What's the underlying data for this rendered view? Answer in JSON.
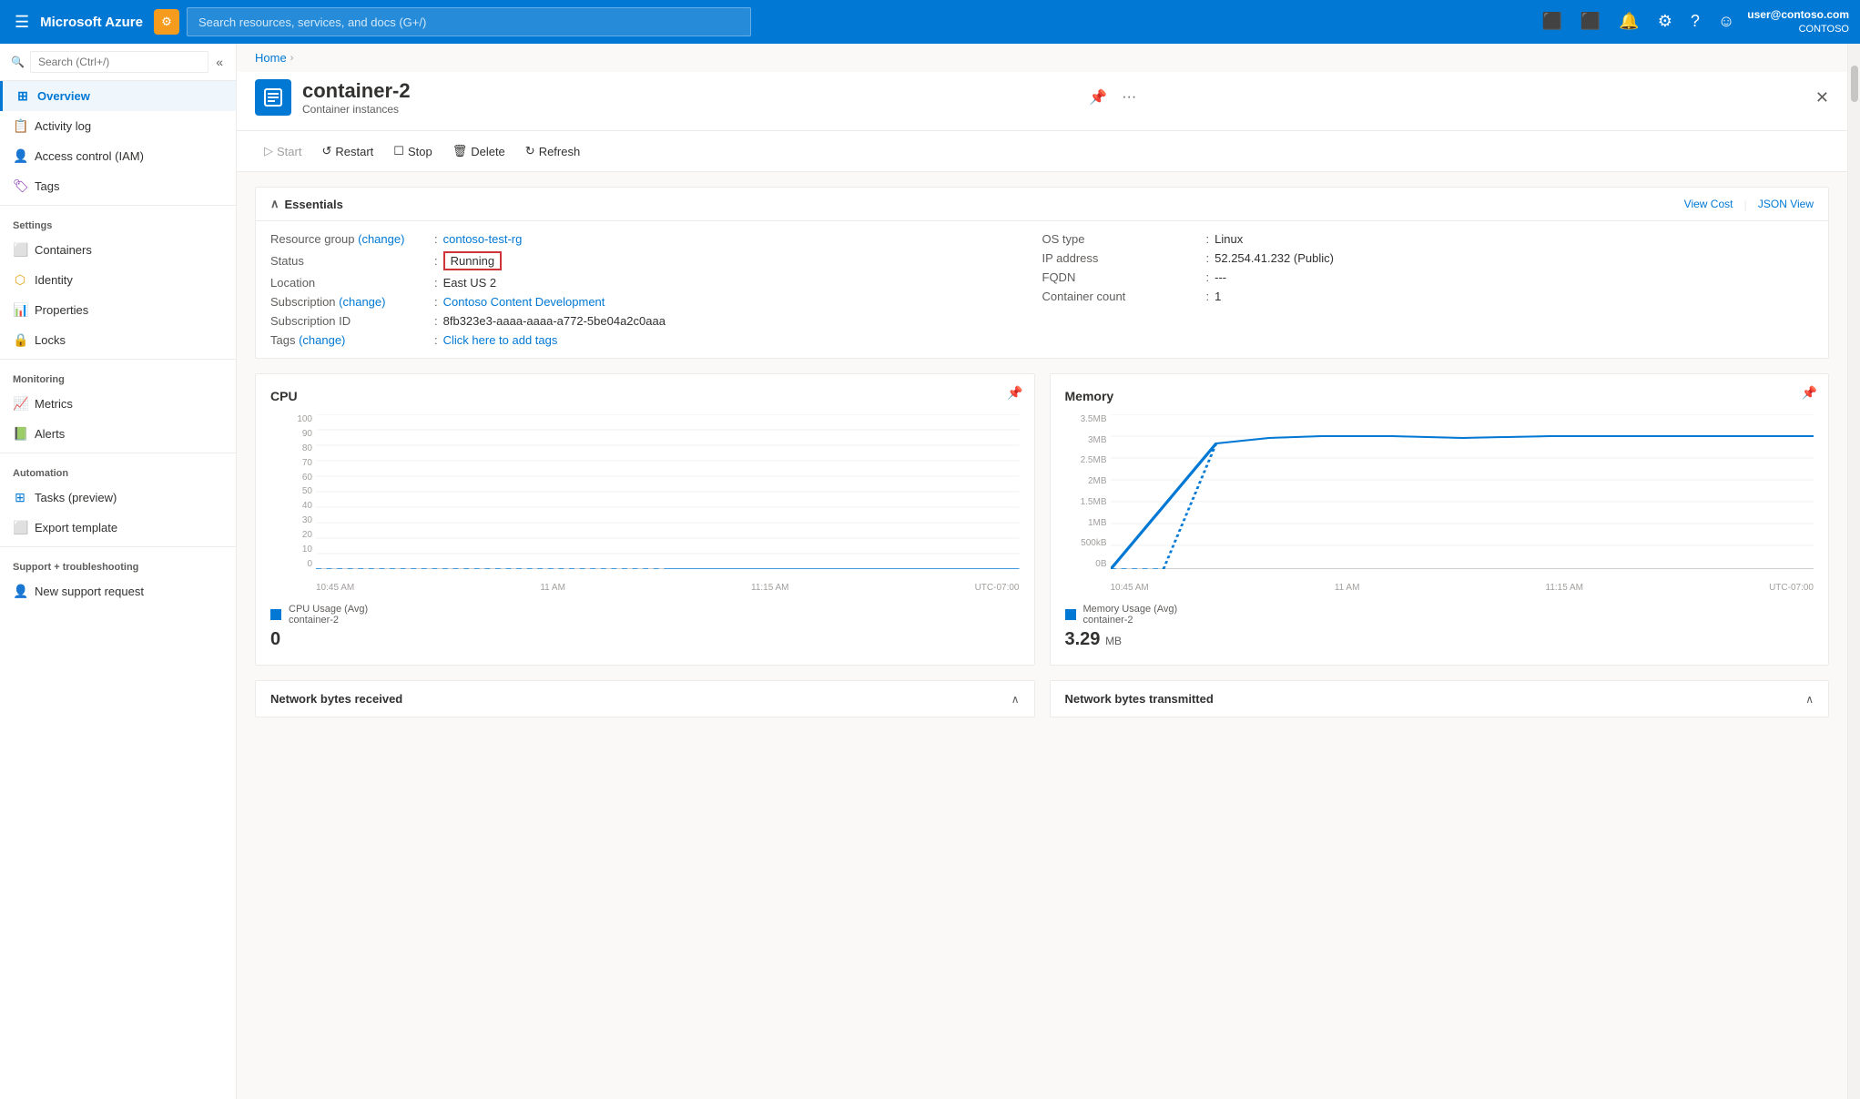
{
  "topbar": {
    "hamburger": "☰",
    "logo": "Microsoft Azure",
    "badge_icon": "⚙",
    "search_placeholder": "Search resources, services, and docs (G+/)",
    "user_email": "user@contoso.com",
    "user_org": "CONTOSO",
    "icons": {
      "portal": "⬛",
      "feedback": "⬛",
      "bell": "🔔",
      "settings": "⚙",
      "help": "?",
      "account": "👤"
    }
  },
  "breadcrumb": {
    "home": "Home",
    "separator": "›"
  },
  "page_header": {
    "title": "container-2",
    "subtitle": "Container instances",
    "pin_icon": "📌",
    "more_icon": "···"
  },
  "toolbar": {
    "start_label": "Start",
    "restart_label": "Restart",
    "stop_label": "Stop",
    "delete_label": "Delete",
    "refresh_label": "Refresh"
  },
  "essentials": {
    "title": "Essentials",
    "view_cost": "View Cost",
    "json_view": "JSON View",
    "left_col": [
      {
        "label": "Resource group (change)",
        "colon": ":",
        "value": "contoso-test-rg",
        "link": true
      },
      {
        "label": "Status",
        "colon": ":",
        "value": "Running",
        "status": true
      },
      {
        "label": "Location",
        "colon": ":",
        "value": "East US 2"
      },
      {
        "label": "Subscription (change)",
        "colon": ":",
        "value": "Contoso Content Development",
        "link": true
      },
      {
        "label": "Subscription ID",
        "colon": ":",
        "value": "8fb323e3-aaaa-aaaa-a772-5be04a2c0aaa"
      },
      {
        "label": "Tags (change)",
        "colon": ":",
        "value": "Click here to add tags",
        "link": true
      }
    ],
    "right_col": [
      {
        "label": "OS type",
        "colon": ":",
        "value": "Linux"
      },
      {
        "label": "IP address",
        "colon": ":",
        "value": "52.254.41.232 (Public)"
      },
      {
        "label": "FQDN",
        "colon": ":",
        "value": "---"
      },
      {
        "label": "Container count",
        "colon": ":",
        "value": "1"
      }
    ]
  },
  "sidebar": {
    "search_placeholder": "Search (Ctrl+/)",
    "items": [
      {
        "id": "overview",
        "label": "Overview",
        "icon": "⊞",
        "active": true,
        "section": null
      },
      {
        "id": "activity-log",
        "label": "Activity log",
        "icon": "📋",
        "active": false,
        "section": null
      },
      {
        "id": "access-control",
        "label": "Access control (IAM)",
        "icon": "👤",
        "active": false,
        "section": null
      },
      {
        "id": "tags",
        "label": "Tags",
        "icon": "🏷",
        "active": false,
        "section": null
      },
      {
        "id": "settings-header",
        "label": "Settings",
        "icon": null,
        "active": false,
        "section": "header"
      },
      {
        "id": "containers",
        "label": "Containers",
        "icon": "⬜",
        "active": false,
        "section": "settings"
      },
      {
        "id": "identity",
        "label": "Identity",
        "icon": "⬡",
        "active": false,
        "section": "settings"
      },
      {
        "id": "properties",
        "label": "Properties",
        "icon": "📊",
        "active": false,
        "section": "settings"
      },
      {
        "id": "locks",
        "label": "Locks",
        "icon": "🔒",
        "active": false,
        "section": "settings"
      },
      {
        "id": "monitoring-header",
        "label": "Monitoring",
        "icon": null,
        "active": false,
        "section": "header"
      },
      {
        "id": "metrics",
        "label": "Metrics",
        "icon": "📈",
        "active": false,
        "section": "monitoring"
      },
      {
        "id": "alerts",
        "label": "Alerts",
        "icon": "📗",
        "active": false,
        "section": "monitoring"
      },
      {
        "id": "automation-header",
        "label": "Automation",
        "icon": null,
        "active": false,
        "section": "header"
      },
      {
        "id": "tasks",
        "label": "Tasks (preview)",
        "icon": "⊞",
        "active": false,
        "section": "automation"
      },
      {
        "id": "export-template",
        "label": "Export template",
        "icon": "⬜",
        "active": false,
        "section": "automation"
      },
      {
        "id": "support-header",
        "label": "Support + troubleshooting",
        "icon": null,
        "active": false,
        "section": "header"
      },
      {
        "id": "new-support",
        "label": "New support request",
        "icon": "👤",
        "active": false,
        "section": "support"
      }
    ]
  },
  "cpu_chart": {
    "title": "CPU",
    "y_labels": [
      "100",
      "90",
      "80",
      "70",
      "60",
      "50",
      "40",
      "30",
      "20",
      "10",
      "0"
    ],
    "x_labels": [
      "10:45 AM",
      "11 AM",
      "11:15 AM",
      "UTC-07:00"
    ],
    "legend_label": "CPU Usage (Avg)\ncontainer-2",
    "legend_value": "0",
    "unit": ""
  },
  "memory_chart": {
    "title": "Memory",
    "y_labels": [
      "3.5MB",
      "3MB",
      "2.5MB",
      "2MB",
      "1.5MB",
      "1MB",
      "500kB",
      "0B"
    ],
    "x_labels": [
      "10:45 AM",
      "11 AM",
      "11:15 AM",
      "UTC-07:00"
    ],
    "legend_label": "Memory Usage (Avg)\ncontainer-2",
    "legend_value": "3.29",
    "unit": "MB"
  },
  "network": {
    "received_title": "Network bytes received",
    "transmitted_title": "Network bytes transmitted"
  }
}
